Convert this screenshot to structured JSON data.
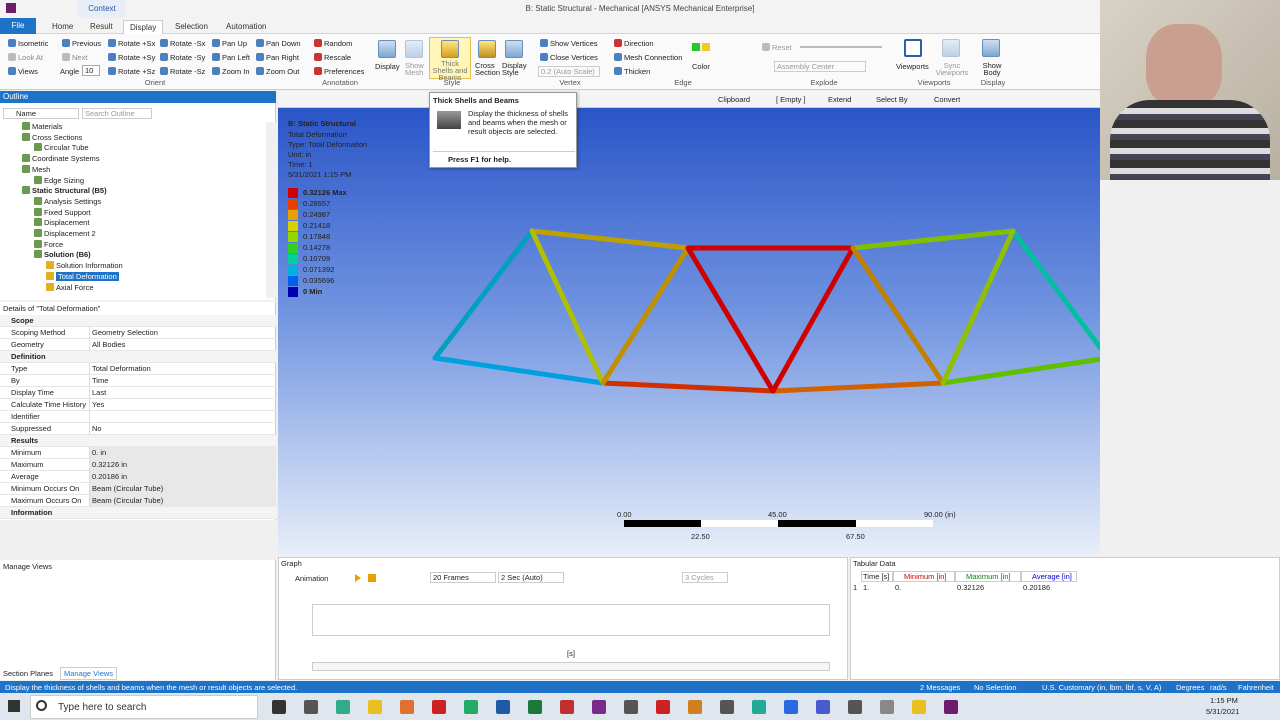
{
  "app": {
    "title": "B: Static Structural - Mechanical [ANSYS Mechanical Enterprise]",
    "context_tab": "Context"
  },
  "tabs": [
    "File",
    "Home",
    "Result",
    "Display",
    "Selection",
    "Automation"
  ],
  "ribbon": {
    "orient": {
      "label": "Orient",
      "items": [
        "Isometric",
        "Previous",
        "Rotate +Sx",
        "Rotate -Sx",
        "Pan Up",
        "Pan Down",
        "Look At",
        "Next",
        "Rotate +Sy",
        "Rotate -Sy",
        "Pan Left",
        "Pan Right",
        "Views",
        "Angle",
        "Rotate +Sz",
        "Rotate -Sz",
        "Zoom In",
        "Zoom Out"
      ],
      "angle_value": "10"
    },
    "annotation": {
      "label": "Annotation",
      "items": [
        "Random",
        "Rescale",
        "Preferences"
      ]
    },
    "display_btns": [
      "Display",
      "Show Mesh",
      "Thick Shells and Beams",
      "Cross Section",
      "Display Style"
    ],
    "style_label": "Style",
    "vertex": {
      "label": "Vertex",
      "items": [
        "Show Vertices",
        "Close Vertices",
        "0.2 (Auto Scale)"
      ]
    },
    "edge": {
      "label": "Edge",
      "items": [
        "Direction",
        "Mesh Connection",
        "Thicken",
        "Color"
      ]
    },
    "explode": {
      "label": "Explode",
      "items": [
        "Reset",
        "Assembly Center"
      ]
    },
    "viewports": {
      "label": "Viewports",
      "items": [
        "Viewports",
        "Sync Viewports"
      ]
    },
    "display_grp": {
      "label": "Display",
      "items": [
        "Show Body"
      ]
    }
  },
  "tooltip": {
    "title": "Thick Shells and Beams",
    "body": "Display the thickness of shells and beams when the mesh or result objects are selected.",
    "help": "Press F1 for help."
  },
  "outline": {
    "title": "Outline",
    "name_col": "Name",
    "search": "Search Outline",
    "items": [
      {
        "label": "Materials",
        "indent": 1
      },
      {
        "label": "Cross Sections",
        "indent": 1
      },
      {
        "label": "Circular Tube",
        "indent": 2
      },
      {
        "label": "Coordinate Systems",
        "indent": 1
      },
      {
        "label": "Mesh",
        "indent": 1
      },
      {
        "label": "Edge Sizing",
        "indent": 2
      },
      {
        "label": "Static Structural (B5)",
        "indent": 1
      },
      {
        "label": "Analysis Settings",
        "indent": 2
      },
      {
        "label": "Fixed Support",
        "indent": 2
      },
      {
        "label": "Displacement",
        "indent": 2
      },
      {
        "label": "Displacement 2",
        "indent": 2
      },
      {
        "label": "Force",
        "indent": 2
      },
      {
        "label": "Solution (B6)",
        "indent": 2
      },
      {
        "label": "Solution Information",
        "indent": 3
      },
      {
        "label": "Total Deformation",
        "indent": 3
      },
      {
        "label": "Axial Force",
        "indent": 3
      }
    ]
  },
  "details": {
    "title": "Details of \"Total Deformation\"",
    "rows": [
      {
        "k": "Scope",
        "v": "",
        "sec": true
      },
      {
        "k": "Scoping Method",
        "v": "Geometry Selection"
      },
      {
        "k": "Geometry",
        "v": "All Bodies"
      },
      {
        "k": "Definition",
        "v": "",
        "sec": true
      },
      {
        "k": "Type",
        "v": "Total Deformation"
      },
      {
        "k": "By",
        "v": "Time"
      },
      {
        "k": "Display Time",
        "v": "Last"
      },
      {
        "k": "Calculate Time History",
        "v": "Yes"
      },
      {
        "k": "Identifier",
        "v": ""
      },
      {
        "k": "Suppressed",
        "v": "No"
      },
      {
        "k": "Results",
        "v": "",
        "sec": true
      },
      {
        "k": "Minimum",
        "v": "0. in"
      },
      {
        "k": "Maximum",
        "v": "0.32126 in"
      },
      {
        "k": "Average",
        "v": "0.20186 in"
      },
      {
        "k": "Minimum Occurs On",
        "v": "Beam (Circular Tube)"
      },
      {
        "k": "Maximum Occurs On",
        "v": "Beam (Circular Tube)"
      },
      {
        "k": "Information",
        "v": "",
        "sec": true
      }
    ]
  },
  "manage": {
    "title": "Manage Views",
    "tabs": [
      "Section Planes",
      "Manage Views"
    ]
  },
  "vptools": [
    "Clipboard",
    "[ Empty ]",
    "Extend",
    "Select By",
    "Convert"
  ],
  "result": {
    "head": "B: Static Structural",
    "lines": [
      "Total Deformation",
      "Type: Total Deformation",
      "Unit: in",
      "Time: 1",
      "5/31/2021 1:15 PM"
    ],
    "legend": [
      {
        "label": "0.32126 Max",
        "color": "#d00000"
      },
      {
        "label": "0.28557",
        "color": "#e84000"
      },
      {
        "label": "0.24987",
        "color": "#e8a000"
      },
      {
        "label": "0.21418",
        "color": "#d8d000"
      },
      {
        "label": "0.17848",
        "color": "#90d800"
      },
      {
        "label": "0.14278",
        "color": "#30d020"
      },
      {
        "label": "0.10709",
        "color": "#00d0a0"
      },
      {
        "label": "0.071392",
        "color": "#00b0e0"
      },
      {
        "label": "0.035696",
        "color": "#0060f0"
      },
      {
        "label": "0 Min",
        "color": "#0000b0"
      }
    ]
  },
  "scale": {
    "top": [
      "0.00",
      "45.00",
      "90.00 (in)"
    ],
    "bottom": [
      "22.50",
      "67.50"
    ]
  },
  "graph": {
    "title": "Graph",
    "animation": "Animation",
    "frames": "20 Frames",
    "sec": "2 Sec (Auto)",
    "cycles": "3 Cycles",
    "axis": "[s]"
  },
  "tabular": {
    "title": "Tabular Data",
    "cols": [
      "Time [s]",
      "Minimum [in]",
      "Maximum [in]",
      "Average [in]"
    ],
    "row": [
      "1.",
      "0.",
      "0.32126",
      "0.20186"
    ],
    "rownum": "1"
  },
  "status": {
    "hint": "Display the thickness of shells and beams when the mesh or result objects are selected.",
    "messages": "2 Messages",
    "selection": "No Selection",
    "units": "U.S. Customary (in, lbm, lbf, s, V, A)",
    "deg": "Degrees",
    "rad": "rad/s",
    "temp": "Fahrenheit"
  },
  "taskbar": {
    "search": "Type here to search",
    "time": "1:15 PM",
    "date": "5/31/2021"
  }
}
